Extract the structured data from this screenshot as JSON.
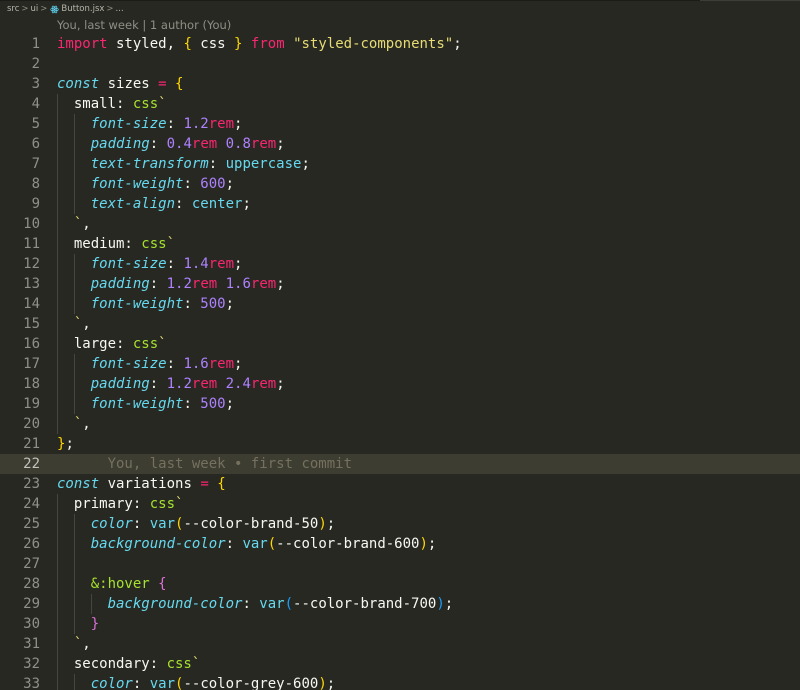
{
  "breadcrumb": {
    "items": [
      "src",
      "ui",
      "Button.jsx",
      "..."
    ],
    "separator": ">"
  },
  "codelens": {
    "text": "You, last week | 1 author (You)"
  },
  "editor": {
    "current_line": 22,
    "inline_blame": "You, last week • first commit",
    "lines": [
      {
        "n": "1",
        "tokens": [
          [
            "kw",
            "import"
          ],
          [
            "plain",
            " styled, "
          ],
          [
            "b1",
            "{"
          ],
          [
            "plain",
            " css "
          ],
          [
            "b1",
            "}"
          ],
          [
            "plain",
            " "
          ],
          [
            "kw",
            "from"
          ],
          [
            "plain",
            " "
          ],
          [
            "str",
            "\"styled-components\""
          ],
          [
            "plain",
            ";"
          ]
        ]
      },
      {
        "n": "2",
        "tokens": []
      },
      {
        "n": "3",
        "tokens": [
          [
            "storage",
            "const"
          ],
          [
            "plain",
            " sizes "
          ],
          [
            "op",
            "="
          ],
          [
            "plain",
            " "
          ],
          [
            "b1",
            "{"
          ]
        ]
      },
      {
        "n": "4",
        "tokens": [
          [
            "plain",
            "  small: "
          ],
          [
            "fn",
            "css"
          ],
          [
            "str",
            "`"
          ]
        ]
      },
      {
        "n": "5",
        "tokens": [
          [
            "plain",
            "    "
          ],
          [
            "prop",
            "font-size"
          ],
          [
            "plain",
            ": "
          ],
          [
            "num",
            "1.2"
          ],
          [
            "unit",
            "rem"
          ],
          [
            "plain",
            ";"
          ]
        ]
      },
      {
        "n": "6",
        "tokens": [
          [
            "plain",
            "    "
          ],
          [
            "prop",
            "padding"
          ],
          [
            "plain",
            ": "
          ],
          [
            "num",
            "0.4"
          ],
          [
            "unit",
            "rem"
          ],
          [
            "plain",
            " "
          ],
          [
            "num",
            "0.8"
          ],
          [
            "unit",
            "rem"
          ],
          [
            "plain",
            ";"
          ]
        ]
      },
      {
        "n": "7",
        "tokens": [
          [
            "plain",
            "    "
          ],
          [
            "prop",
            "text-transform"
          ],
          [
            "plain",
            ": "
          ],
          [
            "val",
            "uppercase"
          ],
          [
            "plain",
            ";"
          ]
        ]
      },
      {
        "n": "8",
        "tokens": [
          [
            "plain",
            "    "
          ],
          [
            "prop",
            "font-weight"
          ],
          [
            "plain",
            ": "
          ],
          [
            "num",
            "600"
          ],
          [
            "plain",
            ";"
          ]
        ]
      },
      {
        "n": "9",
        "tokens": [
          [
            "plain",
            "    "
          ],
          [
            "prop",
            "text-align"
          ],
          [
            "plain",
            ": "
          ],
          [
            "val",
            "center"
          ],
          [
            "plain",
            ";"
          ]
        ]
      },
      {
        "n": "10",
        "tokens": [
          [
            "plain",
            "  "
          ],
          [
            "str",
            "`"
          ],
          [
            "plain",
            ","
          ]
        ]
      },
      {
        "n": "11",
        "tokens": [
          [
            "plain",
            "  medium: "
          ],
          [
            "fn",
            "css"
          ],
          [
            "str",
            "`"
          ]
        ]
      },
      {
        "n": "12",
        "tokens": [
          [
            "plain",
            "    "
          ],
          [
            "prop",
            "font-size"
          ],
          [
            "plain",
            ": "
          ],
          [
            "num",
            "1.4"
          ],
          [
            "unit",
            "rem"
          ],
          [
            "plain",
            ";"
          ]
        ]
      },
      {
        "n": "13",
        "tokens": [
          [
            "plain",
            "    "
          ],
          [
            "prop",
            "padding"
          ],
          [
            "plain",
            ": "
          ],
          [
            "num",
            "1.2"
          ],
          [
            "unit",
            "rem"
          ],
          [
            "plain",
            " "
          ],
          [
            "num",
            "1.6"
          ],
          [
            "unit",
            "rem"
          ],
          [
            "plain",
            ";"
          ]
        ]
      },
      {
        "n": "14",
        "tokens": [
          [
            "plain",
            "    "
          ],
          [
            "prop",
            "font-weight"
          ],
          [
            "plain",
            ": "
          ],
          [
            "num",
            "500"
          ],
          [
            "plain",
            ";"
          ]
        ]
      },
      {
        "n": "15",
        "tokens": [
          [
            "plain",
            "  "
          ],
          [
            "str",
            "`"
          ],
          [
            "plain",
            ","
          ]
        ]
      },
      {
        "n": "16",
        "tokens": [
          [
            "plain",
            "  large: "
          ],
          [
            "fn",
            "css"
          ],
          [
            "str",
            "`"
          ]
        ]
      },
      {
        "n": "17",
        "tokens": [
          [
            "plain",
            "    "
          ],
          [
            "prop",
            "font-size"
          ],
          [
            "plain",
            ": "
          ],
          [
            "num",
            "1.6"
          ],
          [
            "unit",
            "rem"
          ],
          [
            "plain",
            ";"
          ]
        ]
      },
      {
        "n": "18",
        "tokens": [
          [
            "plain",
            "    "
          ],
          [
            "prop",
            "padding"
          ],
          [
            "plain",
            ": "
          ],
          [
            "num",
            "1.2"
          ],
          [
            "unit",
            "rem"
          ],
          [
            "plain",
            " "
          ],
          [
            "num",
            "2.4"
          ],
          [
            "unit",
            "rem"
          ],
          [
            "plain",
            ";"
          ]
        ]
      },
      {
        "n": "19",
        "tokens": [
          [
            "plain",
            "    "
          ],
          [
            "prop",
            "font-weight"
          ],
          [
            "plain",
            ": "
          ],
          [
            "num",
            "500"
          ],
          [
            "plain",
            ";"
          ]
        ]
      },
      {
        "n": "20",
        "tokens": [
          [
            "plain",
            "  "
          ],
          [
            "str",
            "`"
          ],
          [
            "plain",
            ","
          ]
        ]
      },
      {
        "n": "21",
        "tokens": [
          [
            "b1",
            "}"
          ],
          [
            "plain",
            ";"
          ]
        ]
      },
      {
        "n": "22",
        "tokens": [
          [
            "plain",
            "      "
          ],
          [
            "blame",
            "You, last week • first commit"
          ]
        ]
      },
      {
        "n": "23",
        "tokens": [
          [
            "storage",
            "const"
          ],
          [
            "plain",
            " variations "
          ],
          [
            "op",
            "="
          ],
          [
            "plain",
            " "
          ],
          [
            "b1",
            "{"
          ]
        ]
      },
      {
        "n": "24",
        "tokens": [
          [
            "plain",
            "  primary: "
          ],
          [
            "fn",
            "css"
          ],
          [
            "str",
            "`"
          ]
        ]
      },
      {
        "n": "25",
        "tokens": [
          [
            "plain",
            "    "
          ],
          [
            "prop",
            "color"
          ],
          [
            "plain",
            ": "
          ],
          [
            "val",
            "var"
          ],
          [
            "b1",
            "("
          ],
          [
            "plain",
            "--color-brand-50"
          ],
          [
            "b1",
            ")"
          ],
          [
            "plain",
            ";"
          ]
        ]
      },
      {
        "n": "26",
        "tokens": [
          [
            "plain",
            "    "
          ],
          [
            "prop",
            "background-color"
          ],
          [
            "plain",
            ": "
          ],
          [
            "val",
            "var"
          ],
          [
            "b1",
            "("
          ],
          [
            "plain",
            "--color-brand-600"
          ],
          [
            "b1",
            ")"
          ],
          [
            "plain",
            ";"
          ]
        ]
      },
      {
        "n": "27",
        "tokens": []
      },
      {
        "n": "28",
        "tokens": [
          [
            "plain",
            "    "
          ],
          [
            "sel",
            "&:hover"
          ],
          [
            "plain",
            " "
          ],
          [
            "b2",
            "{"
          ]
        ]
      },
      {
        "n": "29",
        "tokens": [
          [
            "plain",
            "      "
          ],
          [
            "prop",
            "background-color"
          ],
          [
            "plain",
            ": "
          ],
          [
            "val",
            "var"
          ],
          [
            "b3",
            "("
          ],
          [
            "plain",
            "--color-brand-700"
          ],
          [
            "b3",
            ")"
          ],
          [
            "plain",
            ";"
          ]
        ]
      },
      {
        "n": "30",
        "tokens": [
          [
            "plain",
            "    "
          ],
          [
            "b2",
            "}"
          ]
        ]
      },
      {
        "n": "31",
        "tokens": [
          [
            "plain",
            "  "
          ],
          [
            "str",
            "`"
          ],
          [
            "plain",
            ","
          ]
        ]
      },
      {
        "n": "32",
        "tokens": [
          [
            "plain",
            "  secondary: "
          ],
          [
            "fn",
            "css"
          ],
          [
            "str",
            "`"
          ]
        ]
      },
      {
        "n": "33",
        "tokens": [
          [
            "plain",
            "    "
          ],
          [
            "prop",
            "color"
          ],
          [
            "plain",
            ": "
          ],
          [
            "val",
            "var"
          ],
          [
            "b1",
            "("
          ],
          [
            "plain",
            "--color-grey-600"
          ],
          [
            "b1",
            ")"
          ],
          [
            "plain",
            ";"
          ]
        ]
      }
    ]
  },
  "icons": {
    "file_icon": "react-icon"
  },
  "colors": {
    "background": "#272822",
    "keyword": "#f92672",
    "string": "#e6db74",
    "function": "#a6e22e",
    "property": "#66d9ef",
    "number": "#ae81ff",
    "bracket_1": "#ffd700",
    "bracket_2": "#da70d6",
    "bracket_3": "#179fff"
  }
}
